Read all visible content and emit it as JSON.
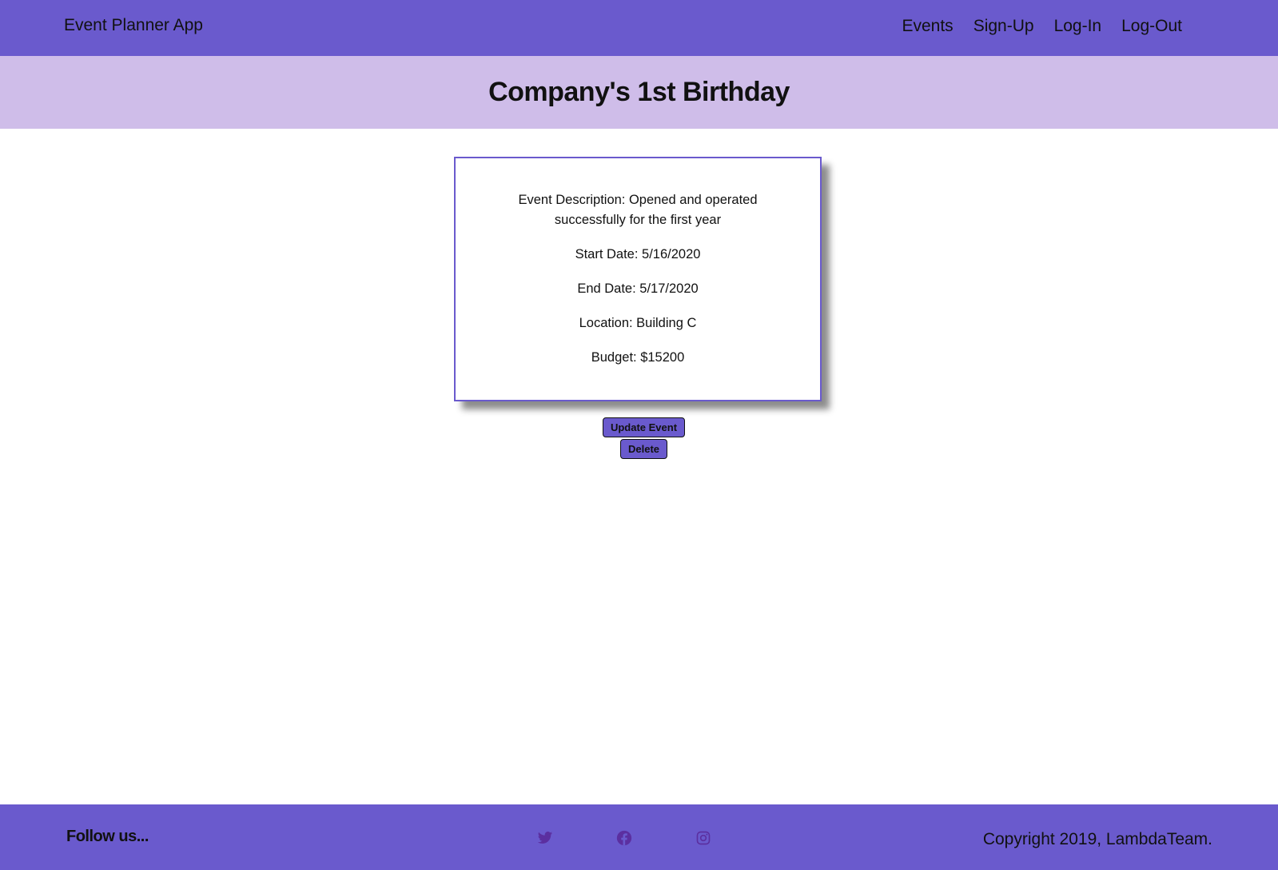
{
  "header": {
    "brand": "Event Planner App",
    "nav": [
      {
        "label": "Events"
      },
      {
        "label": "Sign-Up"
      },
      {
        "label": "Log-In"
      },
      {
        "label": "Log-Out"
      }
    ]
  },
  "hero": {
    "title": "Company's 1st Birthday"
  },
  "event": {
    "description": "Event Description: Opened and operated successfully for the first year",
    "start_date": "Start Date: 5/16/2020",
    "end_date": "End Date: 5/17/2020",
    "location": "Location: Building C",
    "budget": "Budget: $15200"
  },
  "actions": {
    "update_label": "Update Event",
    "delete_label": "Delete"
  },
  "footer": {
    "follow": "Follow us...",
    "socials": [
      {
        "icon": "twitter-icon"
      },
      {
        "icon": "facebook-icon"
      },
      {
        "icon": "instagram-icon"
      }
    ],
    "copyright": "Copyright 2019, LambdaTeam."
  },
  "colors": {
    "primary": "#6a5acd",
    "hero_bg": "#cfbde9",
    "icon": "#5b2fa0"
  }
}
